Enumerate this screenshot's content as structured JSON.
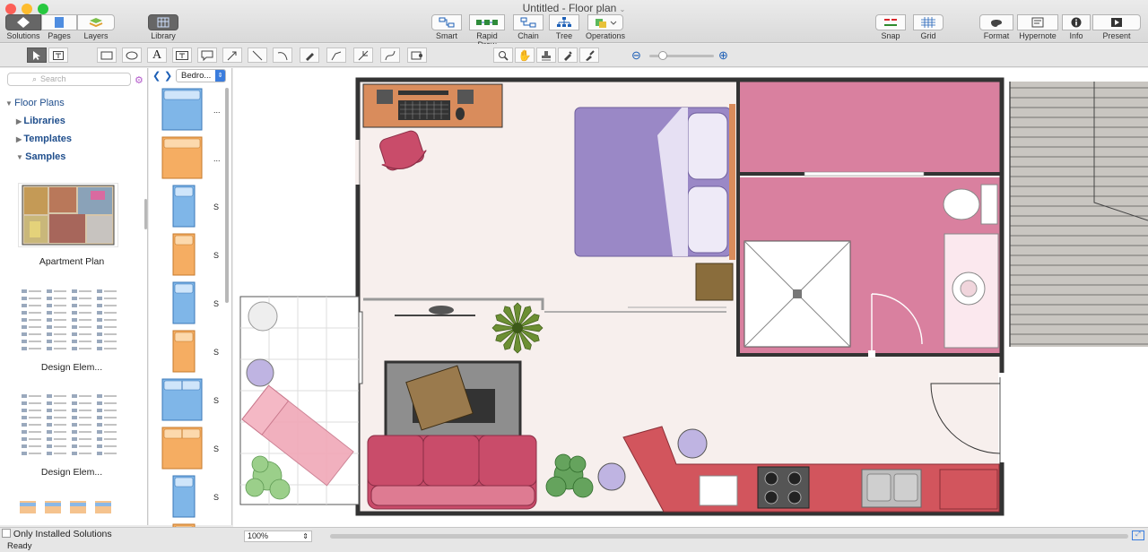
{
  "window": {
    "title": "Untitled - Floor plan"
  },
  "toolbar": {
    "left": [
      {
        "label": "Solutions",
        "icon": "solutions-icon"
      },
      {
        "label": "Pages",
        "icon": "pages-icon"
      },
      {
        "label": "Layers",
        "icon": "layers-icon"
      }
    ],
    "library": {
      "label": "Library",
      "icon": "library-icon"
    },
    "center": [
      {
        "label": "Smart",
        "icon": "smart-connector-icon"
      },
      {
        "label": "Rapid Draw",
        "icon": "rapid-draw-icon"
      },
      {
        "label": "Chain",
        "icon": "chain-icon"
      },
      {
        "label": "Tree",
        "icon": "tree-icon"
      },
      {
        "label": "Operations",
        "icon": "operations-icon"
      }
    ],
    "snap": {
      "label": "Snap",
      "icon": "snap-icon"
    },
    "grid": {
      "label": "Grid",
      "icon": "grid-icon"
    },
    "right": [
      {
        "label": "Format",
        "icon": "format-icon"
      },
      {
        "label": "Hypernote",
        "icon": "hypernote-icon"
      },
      {
        "label": "Info",
        "icon": "info-icon"
      },
      {
        "label": "Present",
        "icon": "present-icon"
      }
    ]
  },
  "solutions": {
    "search_placeholder": "Search",
    "root": "Floor Plans",
    "items": [
      "Libraries",
      "Templates",
      "Samples"
    ],
    "samples": [
      "Apartment Plan",
      "Design Elem...",
      "Design Elem..."
    ],
    "only_installed": "Only Installed Solutions"
  },
  "library": {
    "dropdown": "Bedro...",
    "row_labels": [
      "...",
      "...",
      "S",
      "S",
      "S",
      "S",
      "S",
      "S",
      "S"
    ]
  },
  "status": {
    "zoom": "100%",
    "text": "Ready"
  },
  "colors": {
    "pink": "#d9809f",
    "wall": "#333333",
    "floor": "#f7efed",
    "bed": "#9a88c6",
    "sofa": "#c94c6a",
    "desk": "#d98c5c",
    "counter": "#d2555d"
  }
}
